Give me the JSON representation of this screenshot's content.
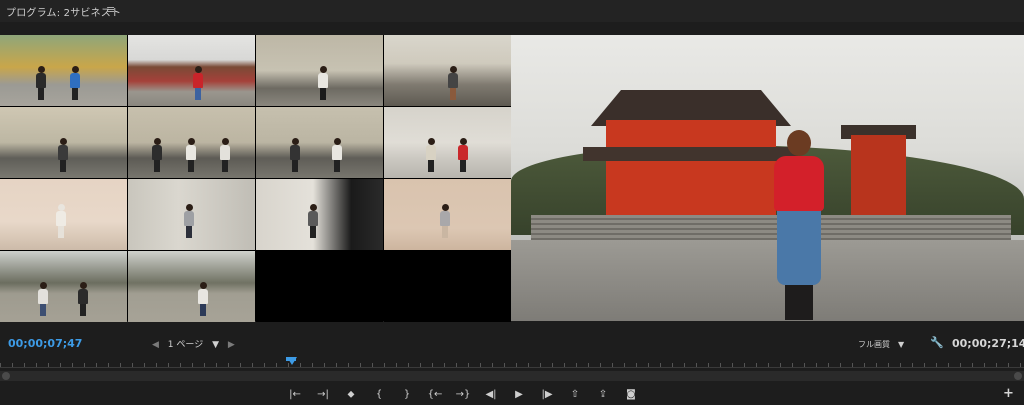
{
  "panel": {
    "title": "プログラム: 2サビネスト",
    "menu_icon": "≡"
  },
  "multicam": {
    "cells": [
      {
        "name": "camera-1"
      },
      {
        "name": "camera-2",
        "active": true
      },
      {
        "name": "camera-3"
      },
      {
        "name": "camera-4"
      },
      {
        "name": "camera-5"
      },
      {
        "name": "camera-6"
      },
      {
        "name": "camera-7"
      },
      {
        "name": "camera-8"
      },
      {
        "name": "camera-9"
      },
      {
        "name": "camera-10"
      },
      {
        "name": "camera-11"
      },
      {
        "name": "camera-12"
      },
      {
        "name": "camera-13"
      },
      {
        "name": "camera-14"
      },
      {
        "name": "camera-15"
      },
      {
        "name": "camera-16"
      }
    ],
    "active_color": "#f2e40a"
  },
  "controls": {
    "timecode_left": "00;00;07;47",
    "page_prev": "◀",
    "page_label": "1 ページ",
    "page_dropdown": "▼",
    "page_next": "▶",
    "quality_label": "フル画質",
    "quality_caret": "▼",
    "settings_icon": "🔧",
    "timecode_right": "00;00;27;14",
    "accent": "#3d9be6"
  },
  "transport": {
    "buttons": [
      {
        "name": "mark-in-button",
        "glyph": "|←"
      },
      {
        "name": "mark-out-button",
        "glyph": "→|"
      },
      {
        "name": "add-marker-button",
        "glyph": "⬥"
      },
      {
        "name": "go-to-in-button",
        "glyph": "{"
      },
      {
        "name": "go-to-out-button",
        "glyph": "}"
      },
      {
        "name": "step-back-to-edit-button",
        "glyph": "{←"
      },
      {
        "name": "step-forward-to-edit-button",
        "glyph": "→}"
      },
      {
        "name": "step-back-button",
        "glyph": "◀|"
      },
      {
        "name": "play-button",
        "glyph": "▶"
      },
      {
        "name": "step-forward-button",
        "glyph": "|▶"
      },
      {
        "name": "lift-button",
        "glyph": "⇧"
      },
      {
        "name": "extract-button",
        "glyph": "⇪"
      },
      {
        "name": "export-frame-button",
        "glyph": "◙"
      }
    ],
    "add_button": "+"
  }
}
